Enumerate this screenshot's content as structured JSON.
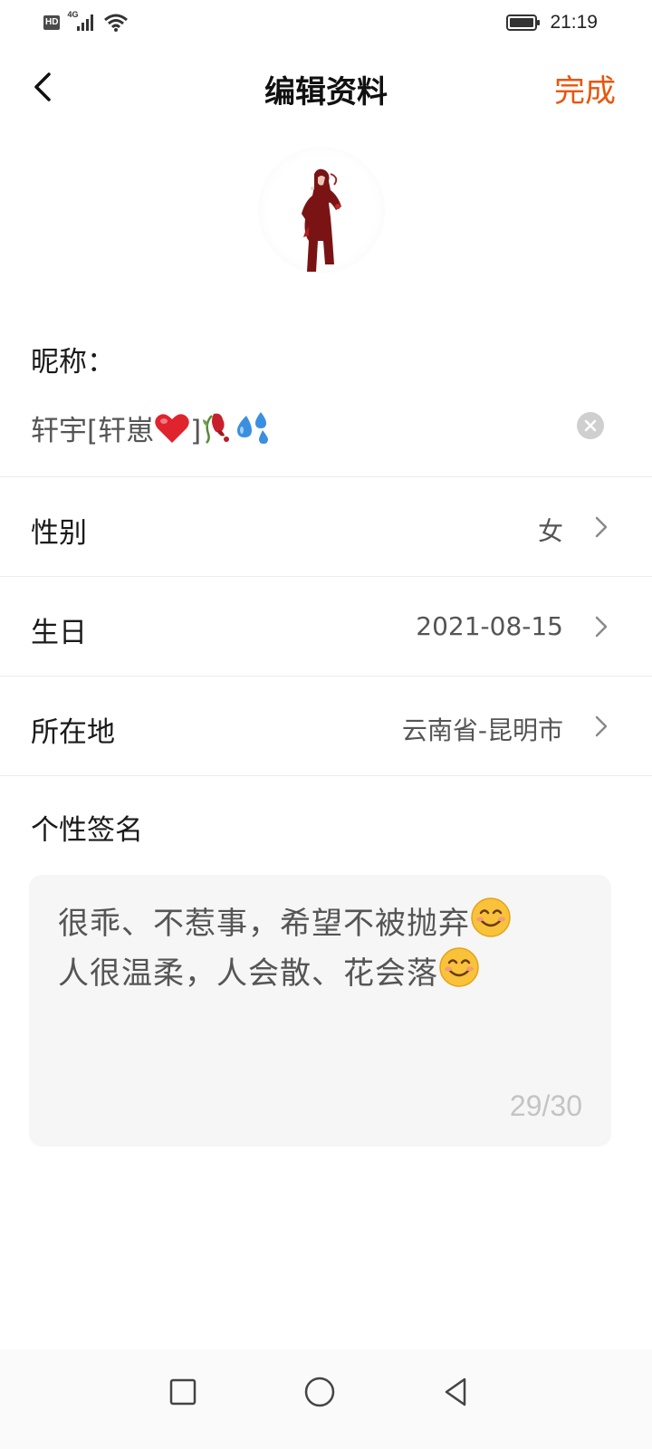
{
  "status_bar": {
    "hd_badge": "HD",
    "network_type": "4G",
    "time": "21:19",
    "icons": [
      "hd-badge",
      "signal-icon",
      "wifi-icon",
      "battery-icon"
    ]
  },
  "header": {
    "title": "编辑资料",
    "done_label": "完成",
    "done_color": "#e8560c",
    "back_icon": "chevron-left-icon"
  },
  "avatar": {
    "icon": "avatar-figure"
  },
  "nickname": {
    "label": "昵称：",
    "value_text": "轩宇[轩崽",
    "value_bracket": "]",
    "emojis": [
      "heart-emoji",
      "wilted-rose-emoji",
      "sweat-droplets-emoji"
    ],
    "clear_icon": "clear-icon"
  },
  "rows": [
    {
      "label": "性别",
      "value": "女",
      "icon": "chevron-right-icon"
    },
    {
      "label": "生日",
      "value": "2021-08-15",
      "icon": "chevron-right-icon"
    },
    {
      "label": "所在地",
      "value": "云南省-昆明市",
      "icon": "chevron-right-icon"
    }
  ],
  "signature": {
    "label": "个性签名",
    "line1": "很乖、不惹事，希望不被抛弃",
    "line2": "人很温柔，人会散、花会落",
    "emoji": "smiling-face-emoji",
    "count": "29/30"
  },
  "nav_bar": {
    "icons": [
      "recent-apps-icon",
      "home-icon",
      "back-triangle-icon"
    ]
  }
}
